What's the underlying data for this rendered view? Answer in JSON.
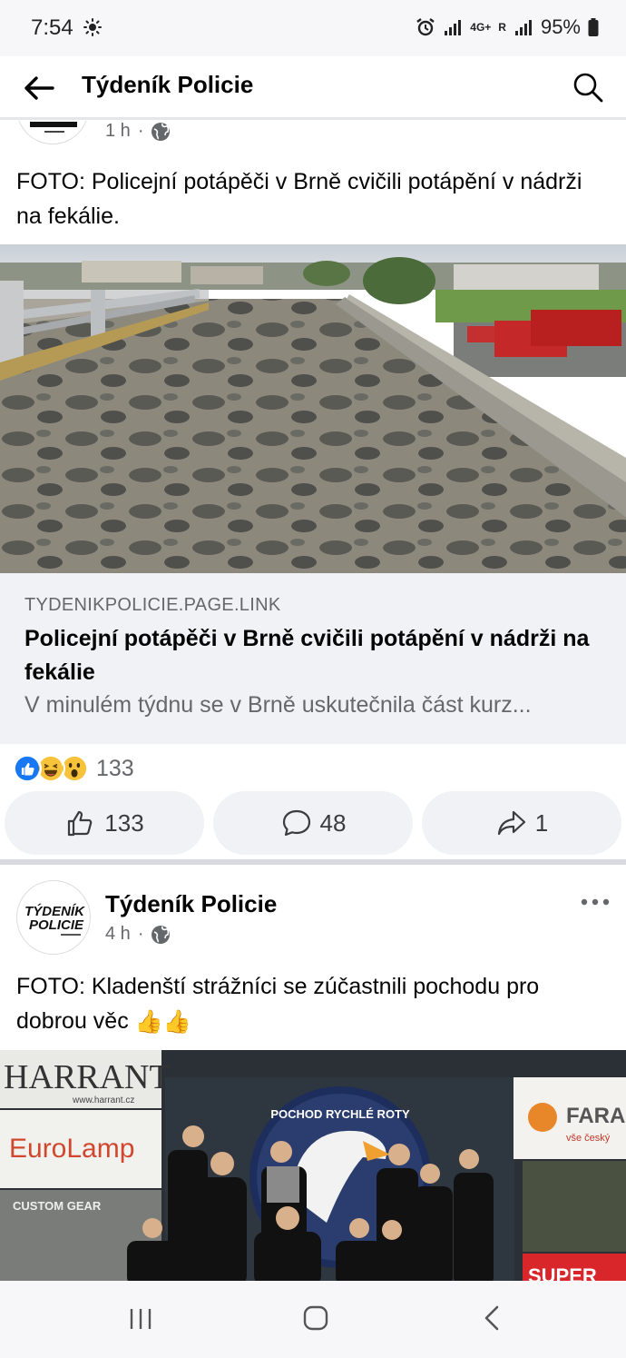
{
  "status_bar": {
    "time": "7:54",
    "network": "4G+",
    "roaming": "R",
    "battery": "95%",
    "icons": [
      "sun-icon",
      "alarm-icon",
      "signal-icon",
      "battery-icon"
    ]
  },
  "header": {
    "title": "Týdeník Policie",
    "icons": [
      "back-arrow-icon",
      "search-icon"
    ]
  },
  "post1": {
    "time": "1 h",
    "separator": "·",
    "text": "FOTO: Policejní potápěči v Brně cvičili potápění v nádrži na fekálie.",
    "link": {
      "domain": "TYDENIKPOLICIE.PAGE.LINK",
      "title": "Policejní potápěči v Brně cvičili potápění v nádrži na fekálie",
      "description": "V minulém týdnu se v Brně uskutečnila část kurz..."
    },
    "reactions": {
      "types": [
        "like-reaction-icon",
        "haha-reaction-icon",
        "wow-reaction-icon"
      ],
      "count": "133"
    },
    "actions": {
      "likes": "133",
      "comments": "48",
      "shares": "1"
    }
  },
  "post2": {
    "page_name": "Týdeník Policie",
    "time": "4 h",
    "separator": "·",
    "text": "FOTO: Kladenští strážníci se zúčastnili pochodu pro dobrou věc",
    "emoji": "👍👍",
    "logo_text": [
      "TÝDENÍK",
      "POLICIE"
    ]
  },
  "photo2_banners": {
    "left_top": "HARRANT",
    "left_url": "www.harrant.cz",
    "left_mid": "EuroLamp",
    "left_bottom": "CUSTOM GEAR",
    "center_arc": "POCHOD RYCHLÉ ROTY",
    "right_top": "FARAN",
    "right_sub": "vše český",
    "right_bottom": "SUPER"
  },
  "colors": {
    "accent": "#1877f2",
    "text": "#050505",
    "secondary": "#65676b",
    "surface": "#f0f2f5"
  }
}
